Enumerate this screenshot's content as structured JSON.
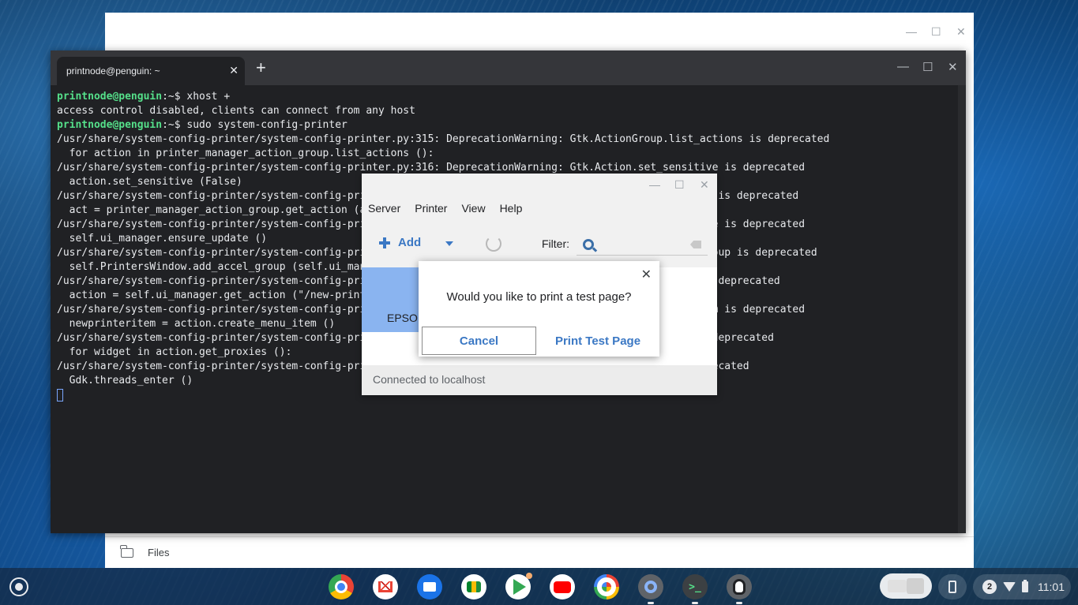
{
  "files_window": {
    "footer_label": "Files",
    "minimize": "—",
    "maximize": "☐",
    "close": "✕"
  },
  "terminal": {
    "tab_title": "printnode@penguin: ~",
    "tab_close": "✕",
    "new_tab": "+",
    "minimize": "—",
    "maximize": "☐",
    "close": "✕",
    "prompt_user": "printnode@penguin",
    "prompt_path": ":~$ ",
    "lines": [
      {
        "type": "prompt",
        "cmd": "xhost +"
      },
      {
        "type": "out",
        "text": "access control disabled, clients can connect from any host"
      },
      {
        "type": "prompt",
        "cmd": "sudo system-config-printer"
      },
      {
        "type": "out",
        "text": "/usr/share/system-config-printer/system-config-printer.py:315: DeprecationWarning: Gtk.ActionGroup.list_actions is deprecated"
      },
      {
        "type": "out",
        "text": "  for action in printer_manager_action_group.list_actions ():"
      },
      {
        "type": "out",
        "text": "/usr/share/system-config-printer/system-config-printer.py:316: DeprecationWarning: Gtk.Action.set_sensitive is deprecated"
      },
      {
        "type": "out",
        "text": "  action.set_sensitive (False)"
      },
      {
        "type": "out",
        "text": "/usr/share/system-config-printer/system-config-pri                                                      on is deprecated"
      },
      {
        "type": "out",
        "text": "  act = printer_manager_action_group.get_action (a"
      },
      {
        "type": "out",
        "text": "/usr/share/system-config-printer/system-config-pri                                                      ate is deprecated"
      },
      {
        "type": "out",
        "text": "  self.ui_manager.ensure_update ()"
      },
      {
        "type": "out",
        "text": "/usr/share/system-config-printer/system-config-pri                                                      group is deprecated"
      },
      {
        "type": "out",
        "text": "  self.PrintersWindow.add_accel_group (self.ui_man"
      },
      {
        "type": "out",
        "text": "/usr/share/system-config-printer/system-config-pri                                                      is deprecated"
      },
      {
        "type": "out",
        "text": "  action = self.ui_manager.get_action (\"/new-print"
      },
      {
        "type": "out",
        "text": "/usr/share/system-config-printer/system-config-pri                                                      tem is deprecated"
      },
      {
        "type": "out",
        "text": "  newprinteritem = action.create_menu_item ()"
      },
      {
        "type": "out",
        "text": "/usr/share/system-config-printer/system-config-pri                                                      s deprecated"
      },
      {
        "type": "out",
        "text": "  for widget in action.get_proxies ():"
      },
      {
        "type": "out",
        "text": "/usr/share/system-config-printer/system-config-pri                                                      precated"
      },
      {
        "type": "out",
        "text": "  Gdk.threads_enter ()"
      }
    ]
  },
  "printer_window": {
    "minimize": "—",
    "maximize": "☐",
    "close": "✕",
    "menu": [
      "Server",
      "Printer",
      "View",
      "Help"
    ],
    "add_label": "Add",
    "filter_label": "Filter:",
    "filter_value": "",
    "printer_name": "EPSON",
    "status": "Connected to localhost"
  },
  "dialog": {
    "close": "✕",
    "message": "Would you like to print a test page?",
    "cancel_label": "Cancel",
    "print_label": "Print Test Page"
  },
  "shelf": {
    "apps": [
      {
        "name": "chrome-app",
        "running": false
      },
      {
        "name": "gmail-app",
        "running": false
      },
      {
        "name": "files-app",
        "running": false
      },
      {
        "name": "meet-app",
        "running": false
      },
      {
        "name": "play-app",
        "running": false
      },
      {
        "name": "youtube-app",
        "running": false
      },
      {
        "name": "photos-app",
        "running": false
      },
      {
        "name": "settings-app",
        "running": true
      },
      {
        "name": "terminal-app",
        "running": true
      },
      {
        "name": "penguin-app",
        "running": true
      }
    ],
    "terminal_glyph": ">_",
    "notification_count": "2",
    "time": "11:01"
  }
}
